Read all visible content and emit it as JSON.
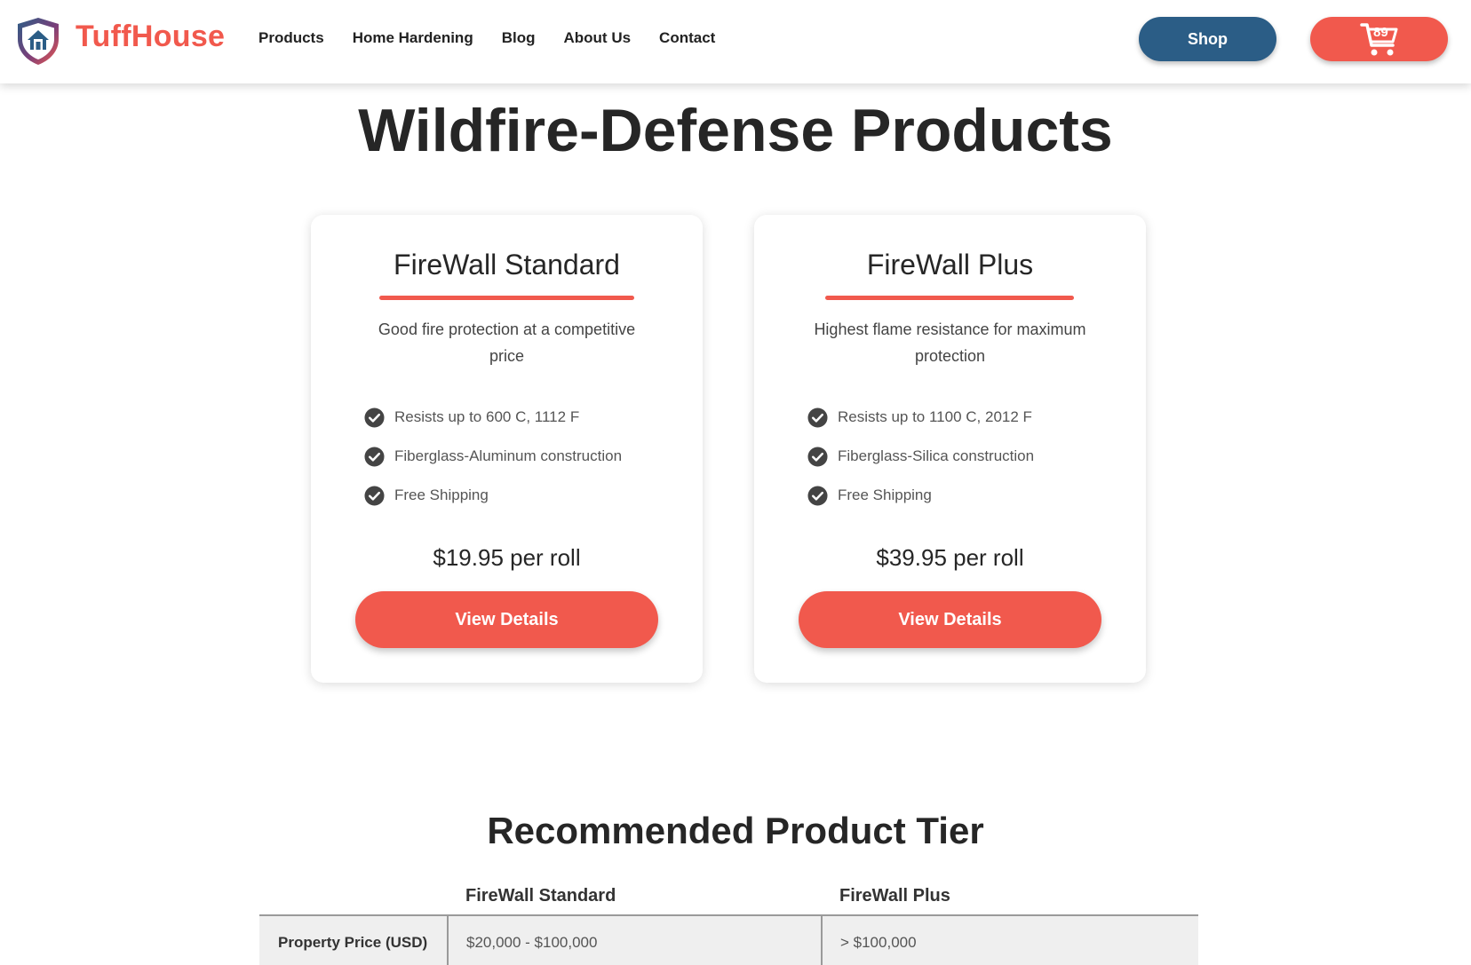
{
  "brand": {
    "name": "TuffHouse",
    "logo_icon": "shield-house-icon",
    "accent": "#f1594d"
  },
  "nav": [
    {
      "label": "Products"
    },
    {
      "label": "Home Hardening"
    },
    {
      "label": "Blog"
    },
    {
      "label": "About Us"
    },
    {
      "label": "Contact"
    }
  ],
  "header": {
    "shop_label": "Shop",
    "shop_color": "#2b5d86",
    "cart_icon": "cart-icon",
    "cart_count": "89"
  },
  "page": {
    "title": "Wildfire-Defense Products"
  },
  "products": [
    {
      "name": "FireWall Standard",
      "description": "Good fire protection at a competitive price",
      "features": [
        "Resists up to 600 C, 1112 F",
        "Fiberglass-Aluminum construction",
        "Free Shipping"
      ],
      "price": "$19.95 per roll",
      "button": "View Details"
    },
    {
      "name": "FireWall Plus",
      "description": "Highest flame resistance for maximum protection",
      "features": [
        "Resists up to 1100 C, 2012 F",
        "Fiberglass-Silica construction",
        "Free Shipping"
      ],
      "price": "$39.95 per roll",
      "button": "View Details"
    }
  ],
  "tier": {
    "title": "Recommended Product Tier",
    "columns": [
      "FireWall Standard",
      "FireWall Plus"
    ],
    "rows": [
      {
        "label": "Property Price (USD)",
        "values": [
          "$20,000 - $100,000",
          "> $100,000"
        ]
      }
    ]
  }
}
